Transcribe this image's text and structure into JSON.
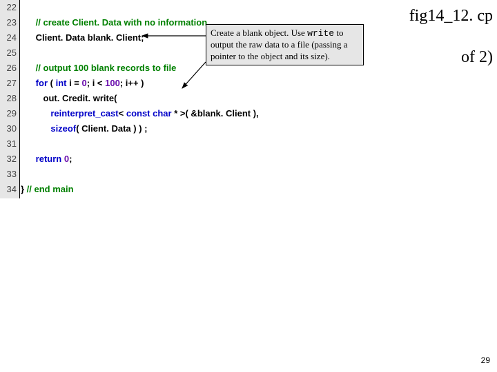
{
  "header": {
    "title": "fig14_12. cp",
    "subtitle": "of 2)"
  },
  "gutter": {
    "start": 22,
    "end": 34
  },
  "code": {
    "l22": "",
    "l23": {
      "indent": "      ",
      "comment": "// create Client. Data with no information"
    },
    "l24": {
      "indent": "      ",
      "text": "Client. Data blank. Client;"
    },
    "l25": "",
    "l26": {
      "indent": "      ",
      "comment": "// output 100 blank records to file"
    },
    "l27": {
      "indent": "      ",
      "kw_for": "for",
      "p1": " ( ",
      "kw_int": "int",
      "p2": " i = ",
      "zero1": "0",
      "p3": "; i < ",
      "hundred": "100",
      "p4": "; i++ )"
    },
    "l28": {
      "indent": "         ",
      "text": "out. Credit. write("
    },
    "l29": {
      "indent": "            ",
      "kw_reint": "reinterpret_cast",
      "p1": "< ",
      "kw_const": "const",
      "sp": " ",
      "kw_char": "char",
      "p2": " * >( &blank. Client ),"
    },
    "l30": {
      "indent": "            ",
      "kw_sizeof": "sizeof",
      "p1": "( Client. Data ) ) ;"
    },
    "l31": "",
    "l32": {
      "indent": "      ",
      "kw_return": "return",
      "sp": " ",
      "zero": "0",
      "semi": ";"
    },
    "l33": "",
    "l34": {
      "indent": "",
      "brace": "} ",
      "comment": "// end main"
    }
  },
  "callout": {
    "t1": "Create a blank object. Use ",
    "mono": "write",
    "t2": " to output the raw data to a file (passing a pointer to the object and its size)."
  },
  "pagenum": "29"
}
